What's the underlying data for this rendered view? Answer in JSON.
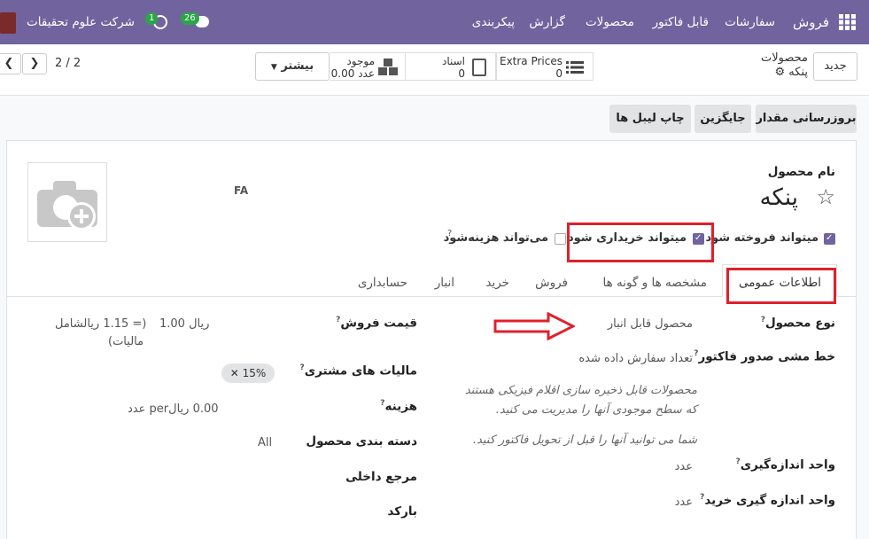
{
  "navbar": {
    "app_name": "فروش",
    "menu": [
      "سفارشات",
      "قابل فاکتور",
      "محصولات",
      "گزارش",
      "پیکربندی"
    ],
    "company": "شرکت علوم تحقیقات",
    "activity_count": "1",
    "message_count": "26"
  },
  "breadcrumb": {
    "parent": "محصولات",
    "current": "پنکه"
  },
  "control": {
    "new_label": "جدید",
    "more_label": "بیشتر",
    "pager": "2 / 2",
    "smart_buttons": [
      {
        "label": "Extra Prices",
        "value": "0"
      },
      {
        "label": "اسناد",
        "value": "0"
      },
      {
        "label": "موجود",
        "value": "0.00 عدد"
      }
    ]
  },
  "actions": {
    "update_qty": "بروزرسانی مقدار",
    "replenish": "جایگزین",
    "print_labels": "چاپ لیبل ها"
  },
  "product": {
    "name_label": "نام محصول",
    "name": "پنکه",
    "lang": "FA",
    "can_be_sold": "میتواند فروخته شود",
    "can_be_purchased": "میتواند خریداری شود",
    "can_be_expensed": "می‌تواند هزینه‌شود"
  },
  "tabs": [
    "اطلاعات عمومی",
    "مشخصه ها و گونه ها",
    "فروش",
    "خرید",
    "انبار",
    "حسابداری"
  ],
  "general": {
    "product_type_label": "نوع محصول",
    "product_type": "محصول قابل انبار",
    "invoice_policy_label": "خط مشی صدور فاکتور",
    "invoice_policy": "تعداد سفارش داده شده",
    "note1_line1": "محصولات قابل ذخیره سازی اقلام فیزیکی هستند",
    "note1_line2": "که سطح موجودی آنها را مدیریت می کنید.",
    "note2": "شما می توانید آنها را قبل از تحویل فاکتور کنید.",
    "uom_label": "واحد اندازه‌گیری",
    "uom": "عدد",
    "purchase_uom_label": "واحد اندازه گیری خرید",
    "purchase_uom": "عدد",
    "sales_price_label": "قیمت فروش",
    "sales_price": "1.00 ریال",
    "sales_price_incl": "(= 1.15 ریالشامل",
    "sales_price_incl2": "مالیات)",
    "customer_taxes_label": "مالیات های مشتری",
    "customer_tax": "15%",
    "cost_label": "هزینه",
    "cost": "0.00 ریالper عدد",
    "category_label": "دسته بندی محصول",
    "category": "All",
    "internal_ref_label": "مرجع داخلی",
    "barcode_label": "بارکد"
  },
  "colors": {
    "brand": "#71639e",
    "highlight": "#e0202b"
  }
}
